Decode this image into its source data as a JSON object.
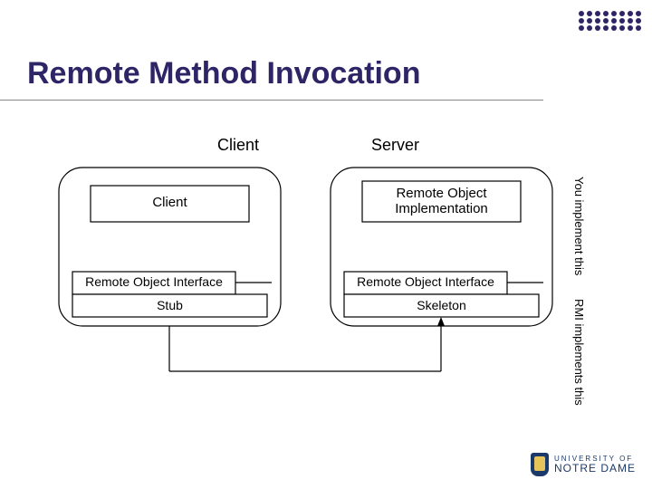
{
  "title": "Remote Method Invocation",
  "columns": {
    "left": "Client",
    "right": "Server"
  },
  "client": {
    "top": "Client",
    "mid": "Remote Object Interface",
    "bottom": "Stub"
  },
  "server": {
    "top_line1": "Remote Object",
    "top_line2": "Implementation",
    "mid": "Remote Object Interface",
    "bottom": "Skeleton"
  },
  "annotations": {
    "you": "You implement this",
    "rmi": "RMI implements this"
  },
  "logo": {
    "line1": "UNIVERSITY OF",
    "line2": "NOTRE DAME"
  }
}
